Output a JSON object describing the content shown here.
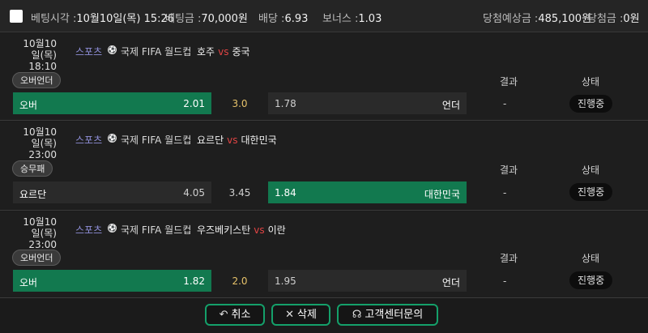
{
  "header": {
    "bet_time_label": "베팅시각 :",
    "bet_time": "10월10일(목) 15:26",
    "bet_amount_label": "베팅금 :",
    "bet_amount": "70,000원",
    "odds_label": "배당 :",
    "odds": "6.93",
    "bonus_label": "보너스 :",
    "bonus": "1.03",
    "expected_label": "당첨예상금 :",
    "expected": "485,100원",
    "won_label": "당첨금 :",
    "won": "0원"
  },
  "columns": {
    "result": "결과",
    "status": "상태"
  },
  "bets": [
    {
      "date": "10월10일(목)",
      "time": "18:10",
      "sport": "스포츠",
      "league": "국제 FIFA 월드컵",
      "home": "호주",
      "vs": "vs",
      "away": "중국",
      "market": "오버언더",
      "left_label": "오버",
      "left_odds": "2.01",
      "mid": "3.0",
      "right_odds": "1.78",
      "right_label": "언더",
      "selected": "left",
      "result": "-",
      "status": "진행중"
    },
    {
      "date": "10월10일(목)",
      "time": "23:00",
      "sport": "스포츠",
      "league": "국제 FIFA 월드컵",
      "home": "요르단",
      "vs": "vs",
      "away": "대한민국",
      "market": "승무패",
      "left_label": "요르단",
      "left_odds": "4.05",
      "mid": "3.45",
      "right_odds": "1.84",
      "right_label": "대한민국",
      "selected": "right",
      "result": "-",
      "status": "진행중"
    },
    {
      "date": "10월10일(목)",
      "time": "23:00",
      "sport": "스포츠",
      "league": "국제 FIFA 월드컵",
      "home": "우즈베키스탄",
      "vs": "vs",
      "away": "이란",
      "market": "오버언더",
      "left_label": "오버",
      "left_odds": "1.82",
      "mid": "2.0",
      "right_odds": "1.95",
      "right_label": "언더",
      "selected": "left",
      "result": "-",
      "status": "진행중"
    }
  ],
  "buttons": {
    "cancel": "취소",
    "delete": "삭제",
    "support": "고객센터문의"
  },
  "icons": {
    "cancel": "undo-icon",
    "delete": "x-icon",
    "support": "headset-icon",
    "ball": "soccer-ball-icon"
  },
  "colors": {
    "selected": "#12794f",
    "accent": "#14a06a",
    "vs": "#e04444",
    "sport": "#8f8fd9",
    "mid_value": "#e6c26a"
  }
}
